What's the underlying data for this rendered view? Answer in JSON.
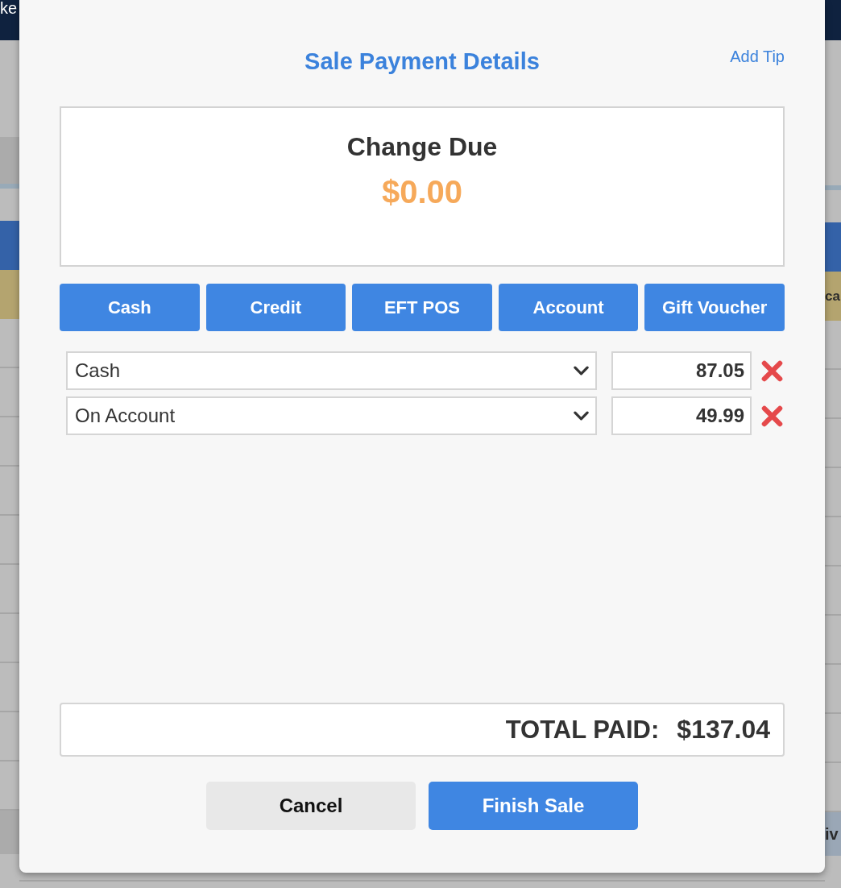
{
  "background_page": {
    "header_fragment": "ke",
    "highlighted_row_fragment": "ca",
    "footer_fragment": "iv"
  },
  "dialog": {
    "title": "Sale Payment Details",
    "add_tip_link": "Add Tip",
    "change_due": {
      "label": "Change Due",
      "amount": "$0.00"
    },
    "payment_type_buttons": [
      "Cash",
      "Credit",
      "EFT POS",
      "Account",
      "Gift Voucher"
    ],
    "payments": [
      {
        "method": "Cash",
        "amount": "87.05"
      },
      {
        "method": "On Account",
        "amount": "49.99"
      }
    ],
    "total_paid": {
      "label": "TOTAL PAID:",
      "amount": "$137.04"
    },
    "buttons": [
      {
        "label": "Cancel",
        "kind": "secondary"
      },
      {
        "label": "Finish Sale",
        "kind": "primary"
      }
    ]
  }
}
